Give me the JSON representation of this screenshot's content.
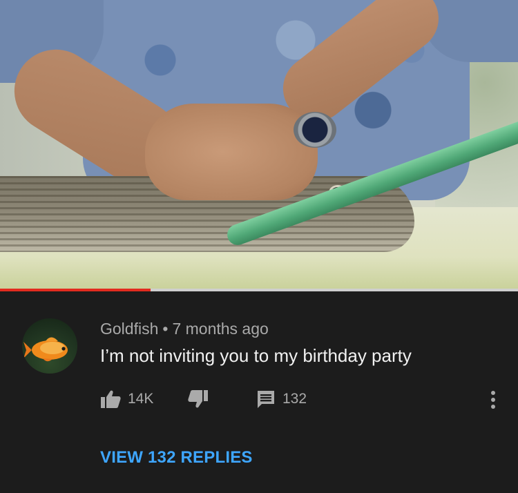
{
  "video": {
    "progress_fraction": 0.29,
    "progress_color": "#e22b1f",
    "track_color": "#cfcfcf"
  },
  "comment": {
    "avatar_icon": "goldfish-avatar",
    "author": "Goldfish",
    "separator": "•",
    "timestamp": "7 months ago",
    "text": "I’m not inviting you to my birthday party",
    "likes": "14K",
    "replies_count": "132",
    "view_replies_label": "VIEW 132 REPLIES"
  },
  "icons": {
    "like": "thumbs-up-icon",
    "dislike": "thumbs-down-icon",
    "reply": "comment-icon",
    "more": "more-vert-icon"
  },
  "colors": {
    "background": "#1c1c1c",
    "link": "#3ea6ff",
    "muted_text": "#aaaaaa",
    "primary_text": "#f1f1f1"
  }
}
